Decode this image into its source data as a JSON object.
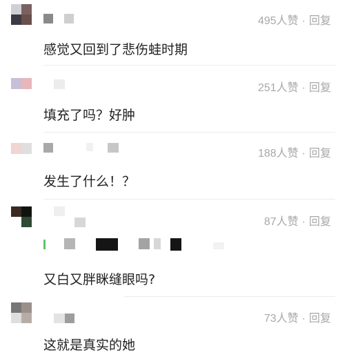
{
  "comments": [
    {
      "likes": "495人赞",
      "reply": "回复",
      "text": "感觉又回到了悲伤蛙时期"
    },
    {
      "likes": "251人赞",
      "reply": "回复",
      "text": "填充了吗？好肿"
    },
    {
      "likes": "188人赞",
      "reply": "回复",
      "text": "发生了什么！？"
    },
    {
      "likes": "87人赞",
      "reply": "回复",
      "text": "又白又胖眯缝眼吗?"
    },
    {
      "likes": "73人赞",
      "reply": "回复",
      "text": "这就是真实的她"
    }
  ],
  "separator": "·",
  "colors": {
    "meta": "#a8a8a8",
    "text": "#222222",
    "divider": "#ececec"
  }
}
